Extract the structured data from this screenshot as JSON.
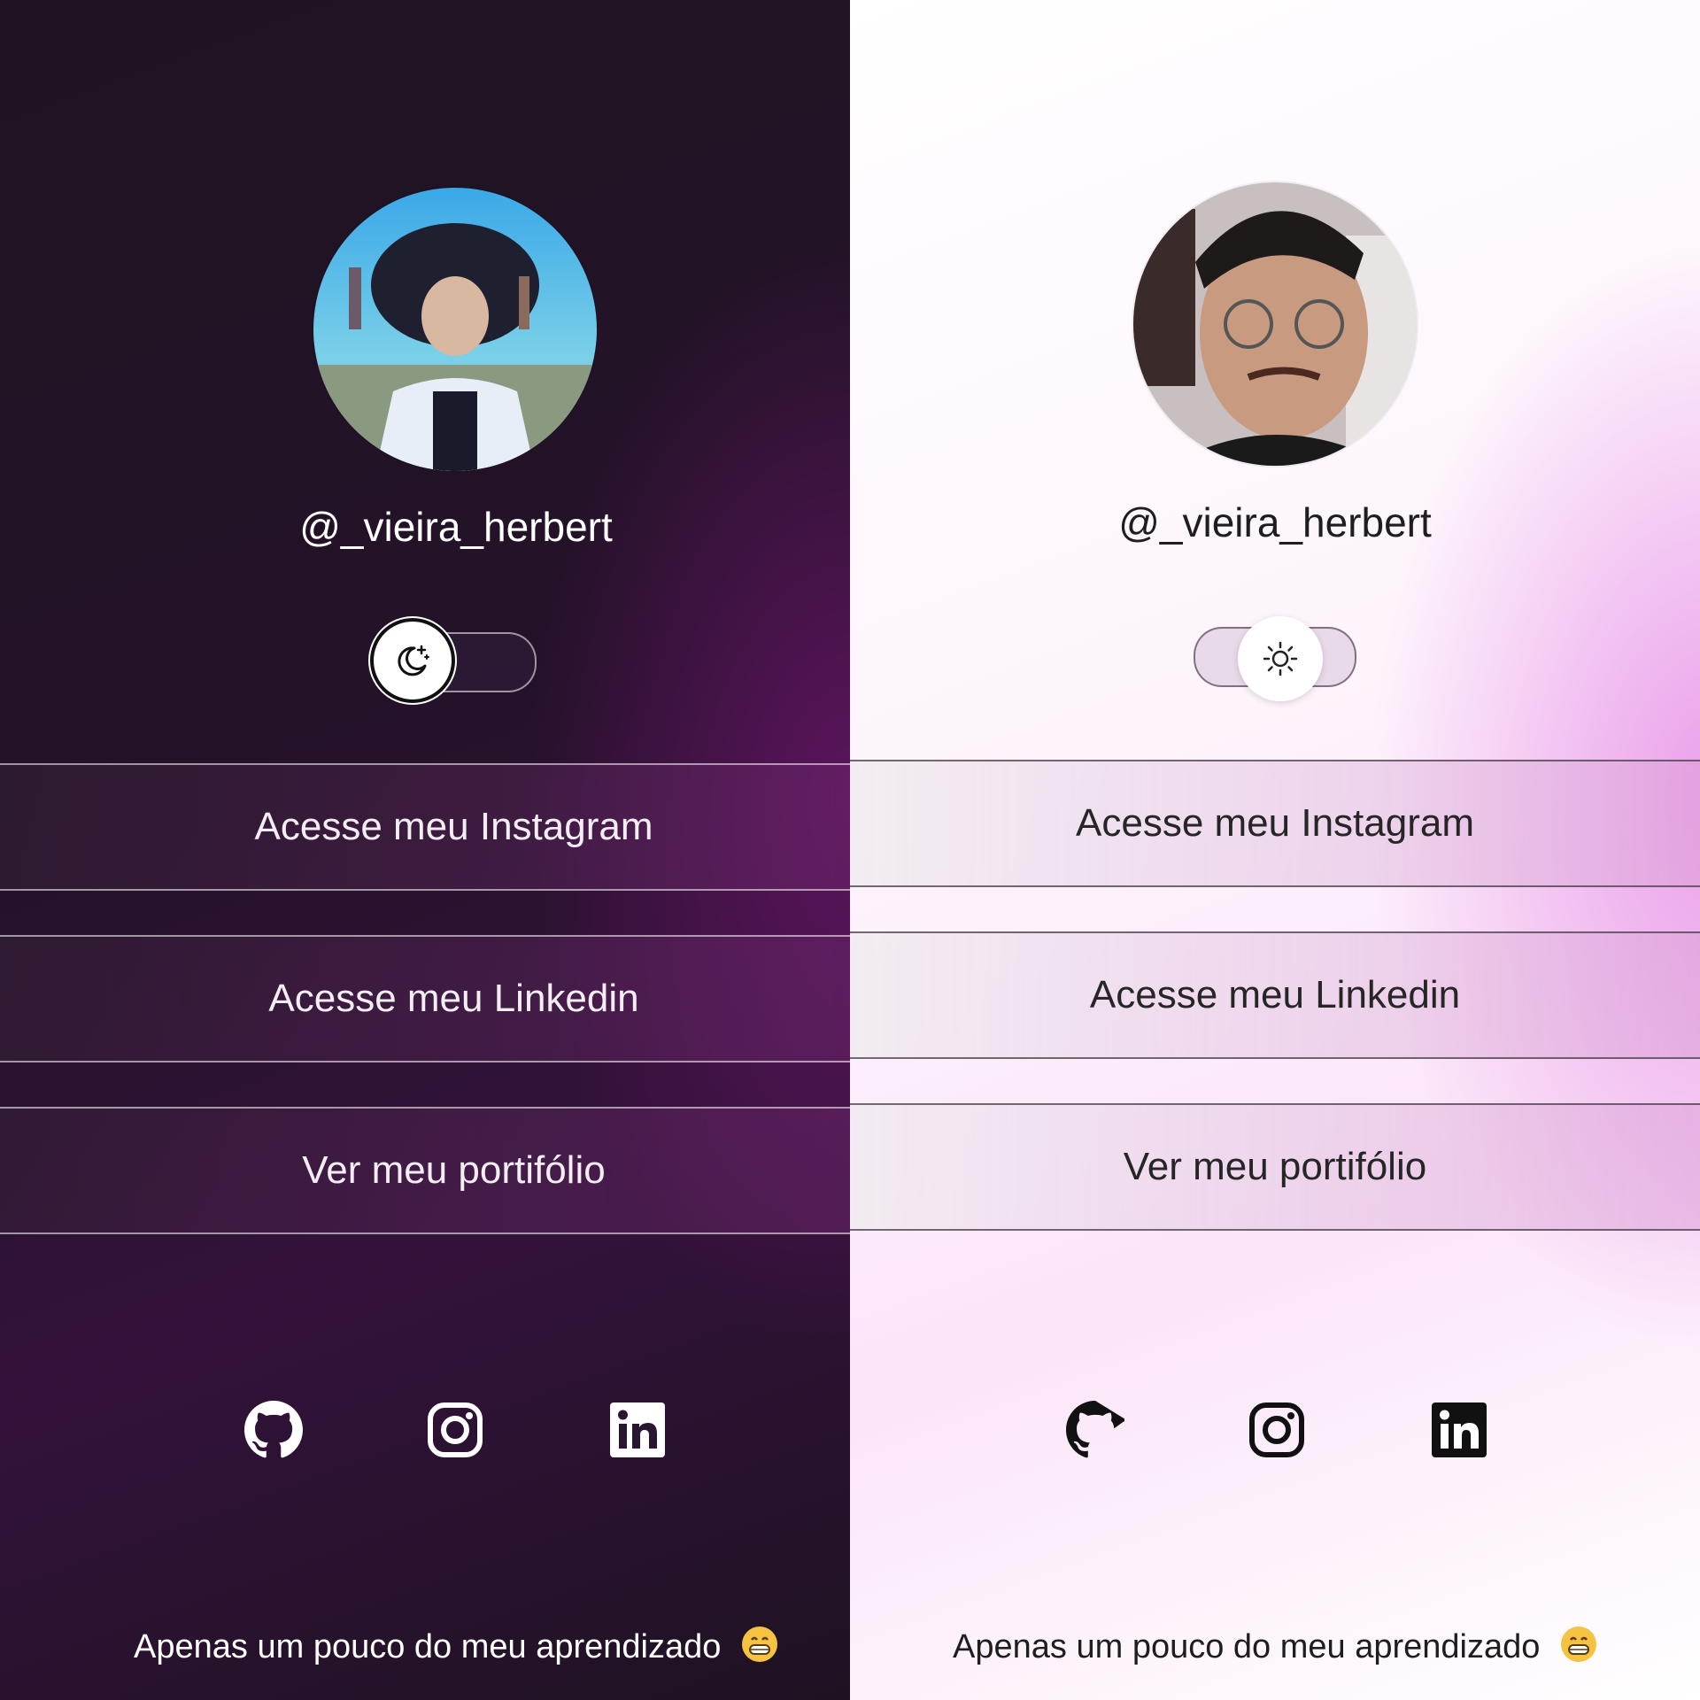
{
  "dark_panel": {
    "theme": "dark",
    "accent": "#5a1a5c",
    "username": "@_vieira_herbert",
    "toggle_icon": "moon-stars-icon",
    "links": [
      {
        "label": "Acesse meu Instagram"
      },
      {
        "label": "Acesse meu Linkedin"
      },
      {
        "label": "Ver meu portifólio"
      }
    ],
    "social_icons": [
      "github-icon",
      "instagram-icon",
      "linkedin-icon"
    ],
    "footer": "Apenas um pouco do meu aprendizado",
    "footer_emoji": "grinning-face-icon"
  },
  "light_panel": {
    "theme": "light",
    "accent": "#e8a0e8",
    "username": "@_vieira_herbert",
    "toggle_icon": "sun-icon",
    "links": [
      {
        "label": "Acesse meu Instagram"
      },
      {
        "label": "Acesse meu Linkedin"
      },
      {
        "label": "Ver meu portifólio"
      }
    ],
    "social_icons": [
      "github-icon",
      "instagram-icon",
      "linkedin-icon"
    ],
    "footer": "Apenas um pouco do meu aprendizado",
    "footer_emoji": "grinning-face-icon"
  }
}
